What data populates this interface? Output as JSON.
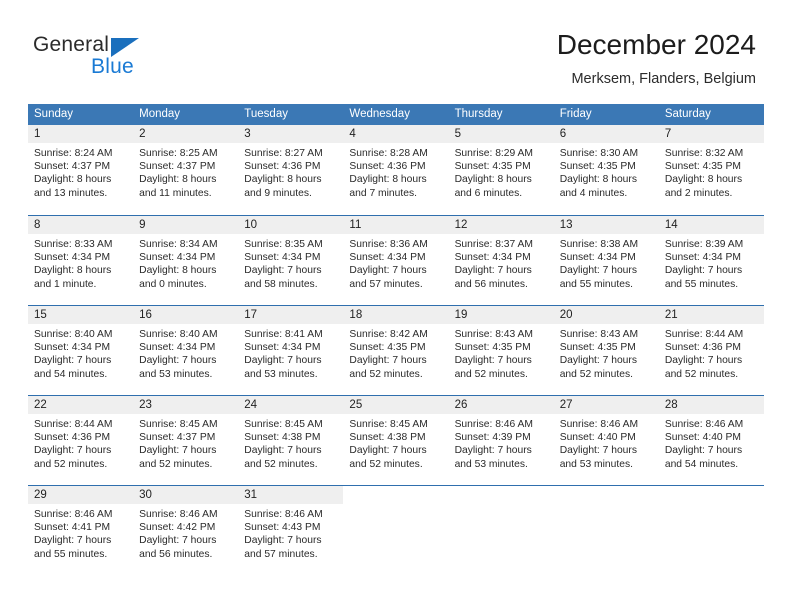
{
  "brand": {
    "name_top": "General",
    "name_bottom": "Blue",
    "triangle_color": "#1a6fbd",
    "blue_text_color": "#1a7ad4"
  },
  "header": {
    "title": "December 2024",
    "subtitle": "Merksem, Flanders, Belgium"
  },
  "theme": {
    "header_band": "#3b78b5",
    "row_divider": "#2f6fae",
    "day_number_band": "#efefef",
    "text": "#222222"
  },
  "weekdays": [
    "Sunday",
    "Monday",
    "Tuesday",
    "Wednesday",
    "Thursday",
    "Friday",
    "Saturday"
  ],
  "weeks": [
    [
      {
        "day": "1",
        "sunrise": "Sunrise: 8:24 AM",
        "sunset": "Sunset: 4:37 PM",
        "daylight_line1": "Daylight: 8 hours",
        "daylight_line2": "and 13 minutes."
      },
      {
        "day": "2",
        "sunrise": "Sunrise: 8:25 AM",
        "sunset": "Sunset: 4:37 PM",
        "daylight_line1": "Daylight: 8 hours",
        "daylight_line2": "and 11 minutes."
      },
      {
        "day": "3",
        "sunrise": "Sunrise: 8:27 AM",
        "sunset": "Sunset: 4:36 PM",
        "daylight_line1": "Daylight: 8 hours",
        "daylight_line2": "and 9 minutes."
      },
      {
        "day": "4",
        "sunrise": "Sunrise: 8:28 AM",
        "sunset": "Sunset: 4:36 PM",
        "daylight_line1": "Daylight: 8 hours",
        "daylight_line2": "and 7 minutes."
      },
      {
        "day": "5",
        "sunrise": "Sunrise: 8:29 AM",
        "sunset": "Sunset: 4:35 PM",
        "daylight_line1": "Daylight: 8 hours",
        "daylight_line2": "and 6 minutes."
      },
      {
        "day": "6",
        "sunrise": "Sunrise: 8:30 AM",
        "sunset": "Sunset: 4:35 PM",
        "daylight_line1": "Daylight: 8 hours",
        "daylight_line2": "and 4 minutes."
      },
      {
        "day": "7",
        "sunrise": "Sunrise: 8:32 AM",
        "sunset": "Sunset: 4:35 PM",
        "daylight_line1": "Daylight: 8 hours",
        "daylight_line2": "and 2 minutes."
      }
    ],
    [
      {
        "day": "8",
        "sunrise": "Sunrise: 8:33 AM",
        "sunset": "Sunset: 4:34 PM",
        "daylight_line1": "Daylight: 8 hours",
        "daylight_line2": "and 1 minute."
      },
      {
        "day": "9",
        "sunrise": "Sunrise: 8:34 AM",
        "sunset": "Sunset: 4:34 PM",
        "daylight_line1": "Daylight: 8 hours",
        "daylight_line2": "and 0 minutes."
      },
      {
        "day": "10",
        "sunrise": "Sunrise: 8:35 AM",
        "sunset": "Sunset: 4:34 PM",
        "daylight_line1": "Daylight: 7 hours",
        "daylight_line2": "and 58 minutes."
      },
      {
        "day": "11",
        "sunrise": "Sunrise: 8:36 AM",
        "sunset": "Sunset: 4:34 PM",
        "daylight_line1": "Daylight: 7 hours",
        "daylight_line2": "and 57 minutes."
      },
      {
        "day": "12",
        "sunrise": "Sunrise: 8:37 AM",
        "sunset": "Sunset: 4:34 PM",
        "daylight_line1": "Daylight: 7 hours",
        "daylight_line2": "and 56 minutes."
      },
      {
        "day": "13",
        "sunrise": "Sunrise: 8:38 AM",
        "sunset": "Sunset: 4:34 PM",
        "daylight_line1": "Daylight: 7 hours",
        "daylight_line2": "and 55 minutes."
      },
      {
        "day": "14",
        "sunrise": "Sunrise: 8:39 AM",
        "sunset": "Sunset: 4:34 PM",
        "daylight_line1": "Daylight: 7 hours",
        "daylight_line2": "and 55 minutes."
      }
    ],
    [
      {
        "day": "15",
        "sunrise": "Sunrise: 8:40 AM",
        "sunset": "Sunset: 4:34 PM",
        "daylight_line1": "Daylight: 7 hours",
        "daylight_line2": "and 54 minutes."
      },
      {
        "day": "16",
        "sunrise": "Sunrise: 8:40 AM",
        "sunset": "Sunset: 4:34 PM",
        "daylight_line1": "Daylight: 7 hours",
        "daylight_line2": "and 53 minutes."
      },
      {
        "day": "17",
        "sunrise": "Sunrise: 8:41 AM",
        "sunset": "Sunset: 4:34 PM",
        "daylight_line1": "Daylight: 7 hours",
        "daylight_line2": "and 53 minutes."
      },
      {
        "day": "18",
        "sunrise": "Sunrise: 8:42 AM",
        "sunset": "Sunset: 4:35 PM",
        "daylight_line1": "Daylight: 7 hours",
        "daylight_line2": "and 52 minutes."
      },
      {
        "day": "19",
        "sunrise": "Sunrise: 8:43 AM",
        "sunset": "Sunset: 4:35 PM",
        "daylight_line1": "Daylight: 7 hours",
        "daylight_line2": "and 52 minutes."
      },
      {
        "day": "20",
        "sunrise": "Sunrise: 8:43 AM",
        "sunset": "Sunset: 4:35 PM",
        "daylight_line1": "Daylight: 7 hours",
        "daylight_line2": "and 52 minutes."
      },
      {
        "day": "21",
        "sunrise": "Sunrise: 8:44 AM",
        "sunset": "Sunset: 4:36 PM",
        "daylight_line1": "Daylight: 7 hours",
        "daylight_line2": "and 52 minutes."
      }
    ],
    [
      {
        "day": "22",
        "sunrise": "Sunrise: 8:44 AM",
        "sunset": "Sunset: 4:36 PM",
        "daylight_line1": "Daylight: 7 hours",
        "daylight_line2": "and 52 minutes."
      },
      {
        "day": "23",
        "sunrise": "Sunrise: 8:45 AM",
        "sunset": "Sunset: 4:37 PM",
        "daylight_line1": "Daylight: 7 hours",
        "daylight_line2": "and 52 minutes."
      },
      {
        "day": "24",
        "sunrise": "Sunrise: 8:45 AM",
        "sunset": "Sunset: 4:38 PM",
        "daylight_line1": "Daylight: 7 hours",
        "daylight_line2": "and 52 minutes."
      },
      {
        "day": "25",
        "sunrise": "Sunrise: 8:45 AM",
        "sunset": "Sunset: 4:38 PM",
        "daylight_line1": "Daylight: 7 hours",
        "daylight_line2": "and 52 minutes."
      },
      {
        "day": "26",
        "sunrise": "Sunrise: 8:46 AM",
        "sunset": "Sunset: 4:39 PM",
        "daylight_line1": "Daylight: 7 hours",
        "daylight_line2": "and 53 minutes."
      },
      {
        "day": "27",
        "sunrise": "Sunrise: 8:46 AM",
        "sunset": "Sunset: 4:40 PM",
        "daylight_line1": "Daylight: 7 hours",
        "daylight_line2": "and 53 minutes."
      },
      {
        "day": "28",
        "sunrise": "Sunrise: 8:46 AM",
        "sunset": "Sunset: 4:40 PM",
        "daylight_line1": "Daylight: 7 hours",
        "daylight_line2": "and 54 minutes."
      }
    ],
    [
      {
        "day": "29",
        "sunrise": "Sunrise: 8:46 AM",
        "sunset": "Sunset: 4:41 PM",
        "daylight_line1": "Daylight: 7 hours",
        "daylight_line2": "and 55 minutes."
      },
      {
        "day": "30",
        "sunrise": "Sunrise: 8:46 AM",
        "sunset": "Sunset: 4:42 PM",
        "daylight_line1": "Daylight: 7 hours",
        "daylight_line2": "and 56 minutes."
      },
      {
        "day": "31",
        "sunrise": "Sunrise: 8:46 AM",
        "sunset": "Sunset: 4:43 PM",
        "daylight_line1": "Daylight: 7 hours",
        "daylight_line2": "and 57 minutes."
      },
      {
        "day": "",
        "sunrise": "",
        "sunset": "",
        "daylight_line1": "",
        "daylight_line2": ""
      },
      {
        "day": "",
        "sunrise": "",
        "sunset": "",
        "daylight_line1": "",
        "daylight_line2": ""
      },
      {
        "day": "",
        "sunrise": "",
        "sunset": "",
        "daylight_line1": "",
        "daylight_line2": ""
      },
      {
        "day": "",
        "sunrise": "",
        "sunset": "",
        "daylight_line1": "",
        "daylight_line2": ""
      }
    ]
  ]
}
